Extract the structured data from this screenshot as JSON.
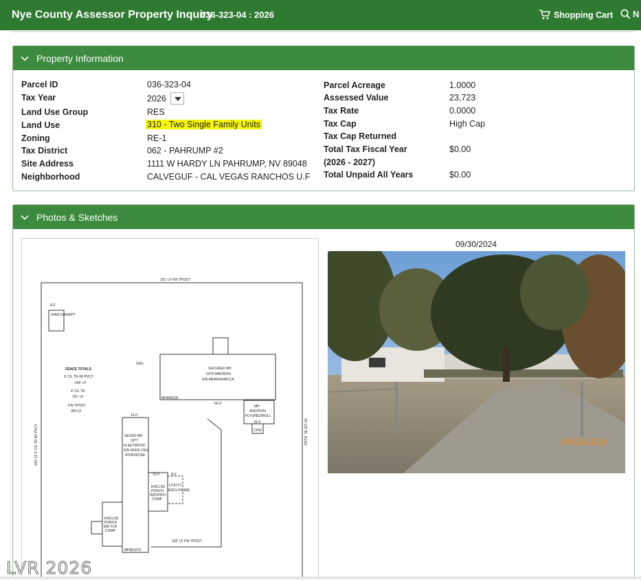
{
  "header": {
    "title": "Nye County Assessor Property Inquiry",
    "parcel": "036-323-04 : 2026",
    "cart_label": "Shopping Cart",
    "search_label": "N"
  },
  "property_panel": {
    "title": "Property Information",
    "left": [
      {
        "label": "Parcel ID",
        "value": "036-323-04"
      },
      {
        "label": "Tax Year",
        "value": "2026"
      },
      {
        "label": "Land Use Group",
        "value": "RES"
      },
      {
        "label": "Land Use",
        "value": "310 - Two Single Family Units"
      },
      {
        "label": "Zoning",
        "value": "RE-1"
      },
      {
        "label": "Tax District",
        "value": "062 - PAHRUMP #2"
      },
      {
        "label": "Site Address",
        "value": "1111 W HARDY LN PAHRUMP, NV 89048"
      },
      {
        "label": "Neighborhood",
        "value": "CALVEGUF - CAL VEGAS RANCHOS U.F"
      }
    ],
    "right": [
      {
        "label": "Parcel Acreage",
        "value": "1.0000"
      },
      {
        "label": "Assessed Value",
        "value": "23,723"
      },
      {
        "label": "Tax Rate",
        "value": "0.0000"
      },
      {
        "label": "Tax Cap",
        "value": "High Cap"
      },
      {
        "label": "Tax Cap Returned",
        "value": ""
      },
      {
        "label": "Total Tax Fiscal Year",
        "value": "$0.00"
      },
      {
        "label": "(2026 - 2027)",
        "value": ""
      },
      {
        "label": "Total Unpaid All Years",
        "value": "$0.00"
      }
    ]
  },
  "photos_panel": {
    "title": "Photos & Sketches",
    "photo_date": "09/30/2024",
    "photo_stamp": "09/30/2024"
  },
  "sketch": {
    "top_label": "101' LF FW TPOST",
    "shed": "SHED EXEMPT",
    "shed_dim": "8.0'",
    "shed_side": "12.0'",
    "fence_title": "FENCE TOTALS",
    "fence_lines": [
      "6' C/L TR W/ PVCY",
      "245' LF",
      "4' C/L TR",
      "161' LF",
      "FW TPOST",
      "353 LF"
    ],
    "gas": "GAS",
    "secured_mh": [
      "SECURED MH",
      "1978 MADISON",
      "S/N AB4400A48CCA"
    ],
    "mh_id1": "MH008130",
    "dim_60": "60.0'",
    "mh_addition": [
      "MH",
      "ADDITION",
      "PLYSHED/ROLL"
    ],
    "dim_16": "16.0'",
    "cpw": "CPW",
    "secrd_mh": [
      "SECRD MH",
      "1977",
      "FLEETWOOD",
      "S/N 26426 CR/L",
      "AT041007EE"
    ],
    "dim_14": "14.0'",
    "enclsd": [
      "ENCLSD",
      "PORCH",
      "WD/VINYL",
      "COMP"
    ],
    "dim_10": "10.0'",
    "dim_8": "8.0'",
    "utility": [
      "UTILITY",
      "ENCLOSURE"
    ],
    "enclsd2": [
      "ENCLSD",
      "PORCH",
      "WD FLR",
      "COMP"
    ],
    "mh_id2": "MH903373",
    "bottom_label": "192' LF FW TPOST",
    "left_side": "240' LF 6' C/L TR W/ PVCY",
    "right_side": "FRTH: 36-327-00"
  },
  "watermark": "LVR 2026",
  "colors": {
    "header": "#2f7a31",
    "panel_head": "#3b8a3d",
    "highlight": "#f6f50a"
  }
}
